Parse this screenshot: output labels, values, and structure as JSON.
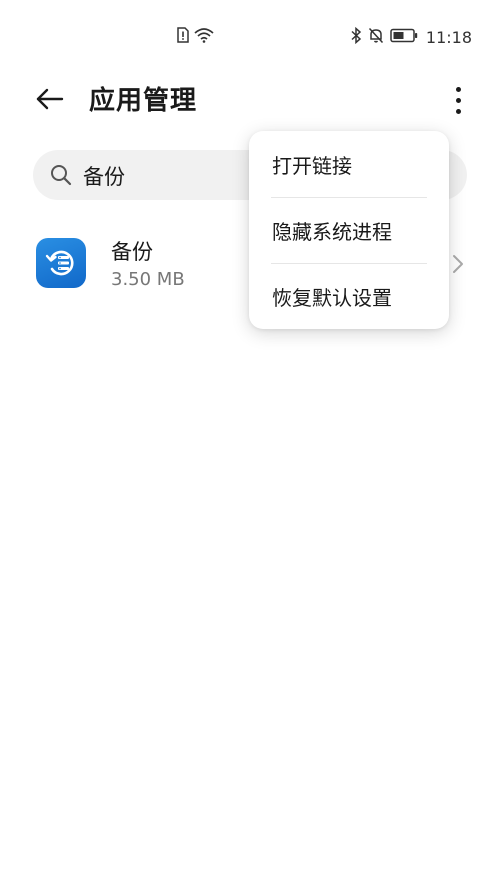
{
  "status_bar": {
    "time": "11:18",
    "icons": [
      "sim-alert-icon",
      "wifi-icon",
      "bluetooth-icon",
      "mute-icon",
      "battery-icon"
    ]
  },
  "header": {
    "title": "应用管理",
    "back_icon": "back-arrow-icon",
    "more_icon": "more-vertical-icon"
  },
  "search": {
    "value": "备份",
    "icon": "search-icon"
  },
  "app_list": [
    {
      "name": "备份",
      "size": "3.50 MB",
      "icon": "backup-app-icon"
    }
  ],
  "menu": {
    "items": [
      {
        "label": "打开链接"
      },
      {
        "label": "隐藏系统进程"
      },
      {
        "label": "恢复默认设置"
      }
    ]
  },
  "colors": {
    "accent": "#1a7ad6",
    "search_bg": "#f1f1f1",
    "text_primary": "#1a1a1a",
    "text_secondary": "#777777"
  }
}
